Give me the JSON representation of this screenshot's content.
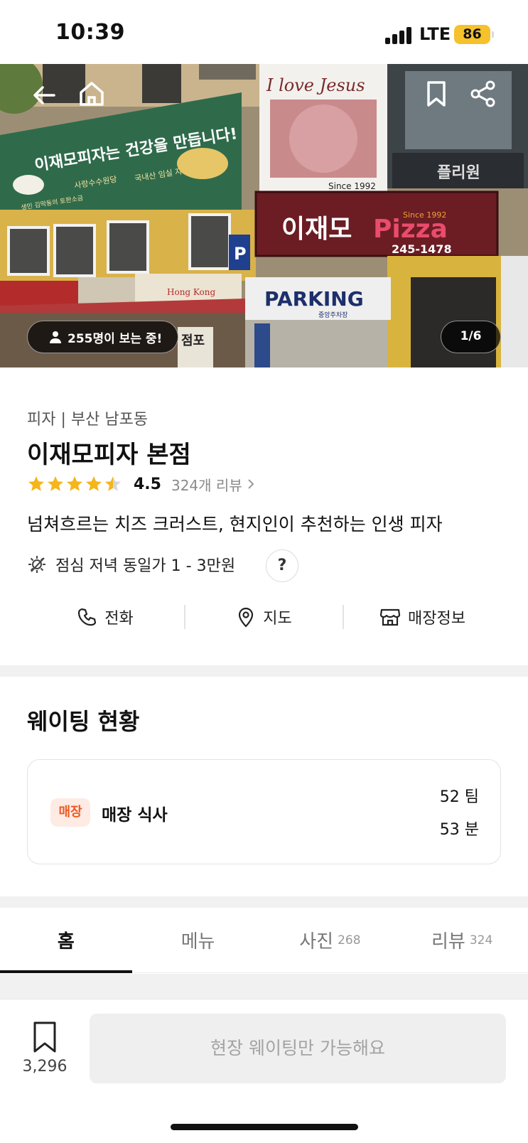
{
  "status_bar": {
    "time": "10:39",
    "network": "LTE",
    "battery": "86"
  },
  "hero": {
    "viewers_text": "255명이 보는 중!",
    "photo_counter": "1/6",
    "sign_text": {
      "banner": "이재모피자는 건강을 만듭니다!",
      "banner_small_1": "사랑수수원당",
      "banner_small_2": "국내산 임실 자연치즈",
      "banner_small_3": "생민 김막동의 토판소금",
      "billboard": "I love Jesus",
      "billboard_since": "Since 1992",
      "store_sign_kr": "이재모",
      "store_sign_en": "Pizza",
      "store_sign_since": "Since 1992",
      "store_phone": "245-1478",
      "parking": "PARKING",
      "parking_sub": "중앙주차장"
    }
  },
  "store": {
    "category": "피자 | 부산 남포동",
    "name": "이재모피자 본점",
    "rating": "4.5",
    "rating_value": 4.5,
    "review_link": "324개 리뷰",
    "tagline": "넘쳐흐르는 치즈 크러스트, 현지인이 추천하는 인생 피자",
    "price": "점심 저녁 동일가 1 - 3만원",
    "help_label": "?"
  },
  "actions": [
    {
      "label": "전화",
      "icon": "phone-icon"
    },
    {
      "label": "지도",
      "icon": "map-pin-icon"
    },
    {
      "label": "매장정보",
      "icon": "store-icon"
    }
  ],
  "waiting": {
    "title": "웨이팅 현황",
    "badge": "매장",
    "label": "매장 식사",
    "teams": "52 팀",
    "minutes": "53 분"
  },
  "tabs": [
    {
      "label": "홈",
      "count": "",
      "active": true
    },
    {
      "label": "메뉴",
      "count": "",
      "active": false
    },
    {
      "label": "사진",
      "count": "268",
      "active": false
    },
    {
      "label": "리뷰",
      "count": "324",
      "active": false
    }
  ],
  "bottom": {
    "save_count": "3,296",
    "cta_label": "현장 웨이팅만 가능해요"
  },
  "colors": {
    "accent": "#ee5a24",
    "star": "#f5b51b",
    "battery": "#f6c22b"
  }
}
